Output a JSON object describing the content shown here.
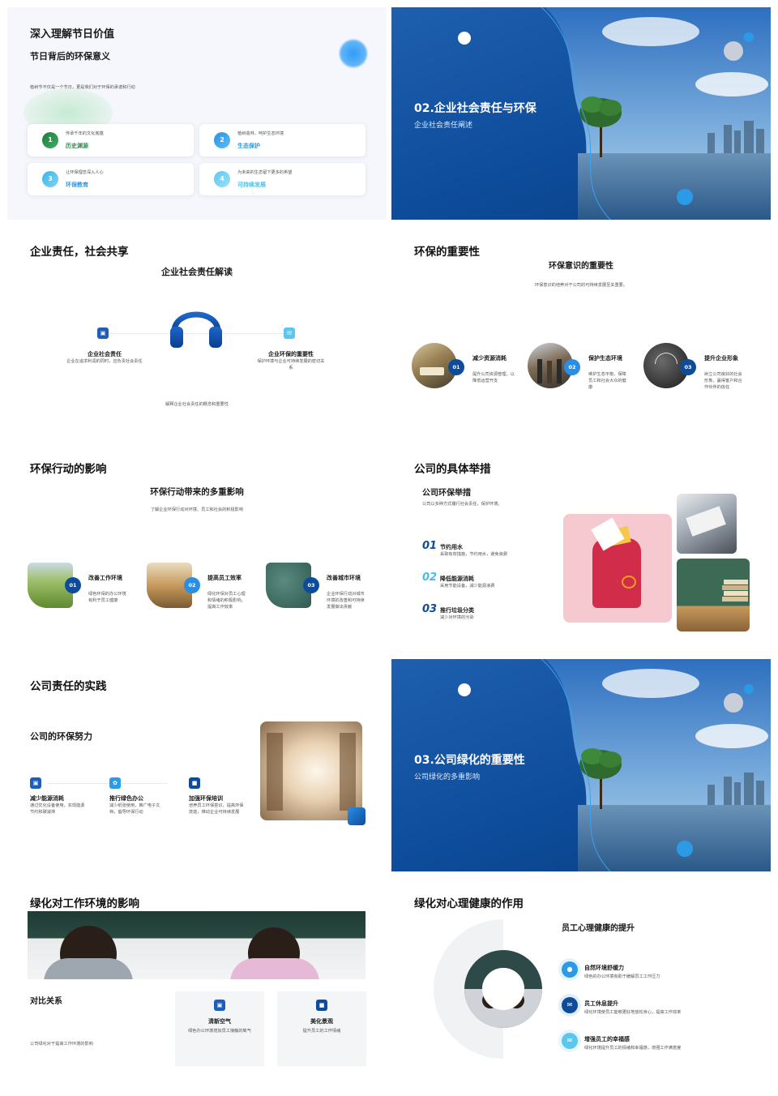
{
  "s1": {
    "title": "深入理解节日价值",
    "subtitle": "节日背后的环保意义",
    "desc": "植树节不仅是一个节日，更是我们对于环保的承诺和行动",
    "cards": [
      {
        "n": "1",
        "small": "传承千年的文化底蕴",
        "label": "历史渊源"
      },
      {
        "n": "2",
        "small": "植树造林，呵护生态环境",
        "label": "生态保护"
      },
      {
        "n": "3",
        "small": "让环保理念深入人心",
        "label": "环保教育"
      },
      {
        "n": "4",
        "small": "为未来的生态留下更多的希望",
        "label": "可持续发展"
      }
    ]
  },
  "s2": {
    "title": "02.企业社会责任与环保",
    "subtitle": "企业社会责任阐述"
  },
  "s3": {
    "title": "企业责任，社会共享",
    "subtitle": "企业社会责任解读",
    "left_title": "企业社会责任",
    "left_desc": "企业在追求利润的同时，应负责社会责任",
    "right_title": "企业环保的重要性",
    "right_desc": "保护环境与企业可持续发展的密切关系",
    "footer": "解释企业社会责任的概念和重要性"
  },
  "s4": {
    "title": "环保的重要性",
    "subtitle": "环保意识的重要性",
    "desc": "环保意识的培养对于公司的可持续发展至关重要。",
    "items": [
      {
        "n": "01",
        "title": "减少资源消耗",
        "desc": "提升公司资源管理，以降低运营开支"
      },
      {
        "n": "02",
        "title": "保护生态环境",
        "desc": "维护生态平衡，保障员工和社会大众的健康"
      },
      {
        "n": "03",
        "title": "提升企业形象",
        "desc": "树立公司良好的社会形象，赢得客户和合作伙伴的信任"
      }
    ]
  },
  "s5": {
    "title": "环保行动的影响",
    "subtitle": "环保行动带来的多重影响",
    "desc": "了解企业环保行动对环境、员工和社会的积极影响",
    "items": [
      {
        "n": "01",
        "title": "改善工作环境",
        "desc": "绿色环保的办公环境有利于员工健康"
      },
      {
        "n": "02",
        "title": "提高员工效率",
        "desc": "绿化环保对员工心理和情绪的积极影响，提高工作效率"
      },
      {
        "n": "03",
        "title": "改善城市环境",
        "desc": "企业环保行动对城市环境的改善和可持续发展做出贡献"
      }
    ]
  },
  "s6": {
    "title": "公司的具体举措",
    "subtitle": "公司环保举措",
    "desc": "公司以多种方式履行社会责任，保护环境。",
    "items": [
      {
        "n": "01",
        "title": "节约用水",
        "desc": "采取有效措施，节约用水，避免浪费"
      },
      {
        "n": "02",
        "title": "降低能源消耗",
        "desc": "采用节能设备，减少能源浪费"
      },
      {
        "n": "03",
        "title": "推行垃圾分类",
        "desc": "减少对环境的污染"
      }
    ]
  },
  "s7": {
    "title": "公司责任的实践",
    "subtitle": "公司的环保努力",
    "items": [
      {
        "title": "减少能源消耗",
        "desc": "通过优化设备使用，实现能源节约和碳减排"
      },
      {
        "title": "推行绿色办公",
        "desc": "减少纸张使用，推广电子文档，倡导环保行动"
      },
      {
        "title": "加强环保培训",
        "desc": "培养员工环保意识，提高环保技能，推动企业可持续发展"
      }
    ]
  },
  "s8": {
    "title": "03.公司绿化的重要性",
    "subtitle": "公司绿化的多重影响"
  },
  "s9": {
    "title": "绿化对工作环境的影响",
    "section": "对比关系",
    "desc": "公司绿化对于提高工作环境的影响",
    "cards": [
      {
        "title": "清新空气",
        "desc": "绿色办公环境增加员工接触的氧气"
      },
      {
        "title": "美化景观",
        "desc": "提升员工的工作情绪"
      }
    ]
  },
  "s10": {
    "title": "绿化对心理健康的作用",
    "subtitle": "员工心理健康的提升",
    "items": [
      {
        "title": "自然环境舒缓力",
        "desc": "绿色的办公环境有助于缓解员工工作压力"
      },
      {
        "title": "员工休息提升",
        "desc": "绿化环境使员工能够更好地放松身心，提高工作效率"
      },
      {
        "title": "增强员工的幸福感",
        "desc": "绿化环境提升员工的情绪和幸福感，增强工作满意度"
      }
    ]
  },
  "colors": {
    "primary": "#1d5fb8",
    "accent": "#2b9be8",
    "green": "#2e8a4e",
    "light_blue": "#3cb4f0"
  }
}
